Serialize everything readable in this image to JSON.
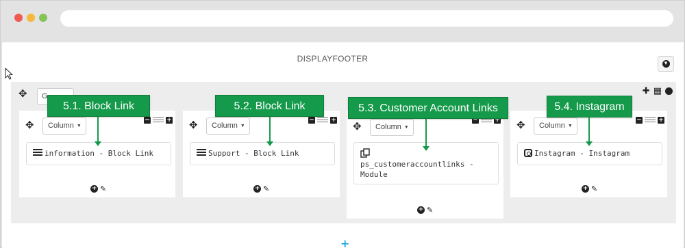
{
  "window": {
    "url": ""
  },
  "hook": {
    "title": "DISPLAYFOOTER"
  },
  "row": {
    "group_label": "G"
  },
  "columns": [
    {
      "button_label": "Column",
      "module_label": "information - Block Link",
      "module_icon": "list-icon"
    },
    {
      "button_label": "Column",
      "module_label": "Support - Block Link",
      "module_icon": "list-icon"
    },
    {
      "button_label": "Column",
      "module_label": "ps_customeraccountlinks - Module",
      "module_icon": "copy-icon"
    },
    {
      "button_label": "Column",
      "module_label": "Instagram - Instagram",
      "module_icon": "instagram-icon"
    }
  ],
  "callouts": [
    "5.1. Block Link",
    "5.2. Block Link",
    "5.3. Customer Account Links",
    "5.4. Instagram"
  ],
  "colors": {
    "callout": "#159a4b",
    "add_row": "#2aa8e0",
    "panel": "#ededed"
  },
  "icons": {
    "move": "move-icon",
    "plus": "plus-circle-icon",
    "edit": "pencil-icon",
    "grid": "grid-icon",
    "collapse": "minus-square-icon",
    "expand": "plus-square-icon"
  }
}
